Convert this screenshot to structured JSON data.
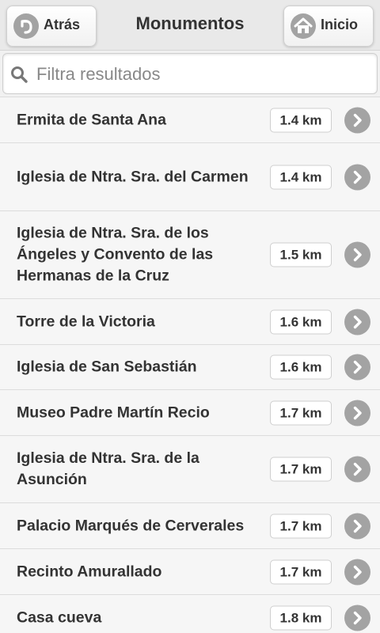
{
  "header": {
    "back_label": "Atrás",
    "title": "Monumentos",
    "home_label": "Inicio"
  },
  "search": {
    "placeholder": "Filtra resultados",
    "value": ""
  },
  "items": [
    {
      "name": "Ermita de Santa Ana",
      "distance": "1.4 km"
    },
    {
      "name": "Iglesia de Ntra. Sra. del Carmen",
      "distance": "1.4 km"
    },
    {
      "name": "Iglesia de Ntra. Sra. de los Ángeles y Convento de las Hermanas de la Cruz",
      "distance": "1.5 km"
    },
    {
      "name": "Torre de la Victoria",
      "distance": "1.6 km"
    },
    {
      "name": "Iglesia de San Sebastián",
      "distance": "1.6 km"
    },
    {
      "name": "Museo Padre Martín Recio",
      "distance": "1.7 km"
    },
    {
      "name": "Iglesia de Ntra. Sra. de la Asunción",
      "distance": "1.7 km"
    },
    {
      "name": "Palacio Marqués de Cerverales",
      "distance": "1.7 km"
    },
    {
      "name": "Recinto Amurallado",
      "distance": "1.7 km"
    },
    {
      "name": "Casa cueva",
      "distance": "1.8 km"
    }
  ],
  "icons": {
    "back": "back-arrow-icon",
    "home": "home-icon",
    "search": "search-icon",
    "row": "chevron-right-icon"
  },
  "colors": {
    "icon_gray": "#a3a3a3",
    "text": "#333333",
    "background": "#f6f6f6"
  }
}
